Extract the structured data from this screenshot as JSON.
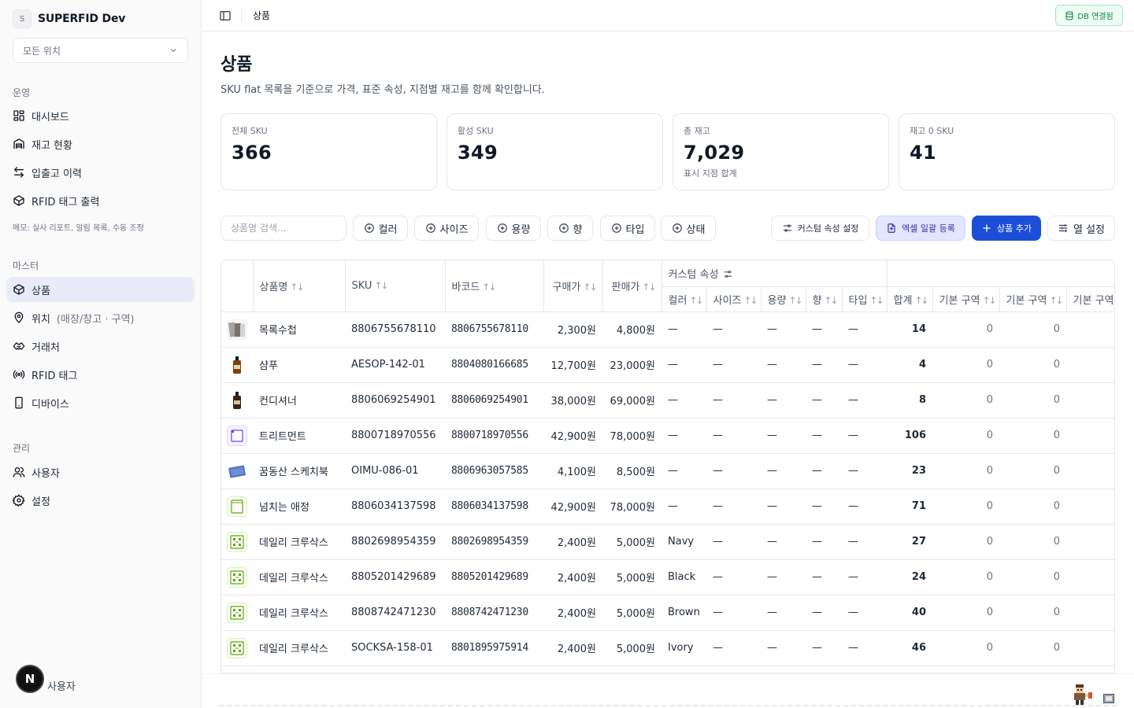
{
  "app": {
    "logo_letter": "S",
    "name": "SUPERFID Dev"
  },
  "location_select": {
    "value": "모든 위치"
  },
  "sidebar": {
    "sections": {
      "operations": "운영",
      "master": "마스터",
      "admin": "관리"
    },
    "items": [
      {
        "id": "dashboard",
        "label": "대시보드"
      },
      {
        "id": "inventory",
        "label": "재고 현황"
      },
      {
        "id": "history",
        "label": "입출고 이력"
      },
      {
        "id": "rfid-print",
        "label": "RFID 태그 출력"
      },
      {
        "id": "products",
        "label": "상품"
      },
      {
        "id": "locations",
        "label": "위치",
        "sub": "(매장/창고 · 구역)"
      },
      {
        "id": "partners",
        "label": "거래처"
      },
      {
        "id": "rfid-tags",
        "label": "RFID 태그"
      },
      {
        "id": "devices",
        "label": "디바이스"
      },
      {
        "id": "users",
        "label": "사용자"
      },
      {
        "id": "settings",
        "label": "설정"
      }
    ],
    "memo": "메모: 실사 리포트, 알림 목록, 수동 조정",
    "user_avatar": "N",
    "user_label": "사용자"
  },
  "topbar": {
    "breadcrumb": "상품",
    "db_status": "DB 연결됨",
    "db_color": "#15803d"
  },
  "page": {
    "title": "상품",
    "description": "SKU flat 목록을 기준으로 가격, 표준 속성, 지점별 재고를 함께 확인합니다."
  },
  "stats": [
    {
      "label": "전체 SKU",
      "value": "366",
      "sub": ""
    },
    {
      "label": "활성 SKU",
      "value": "349",
      "sub": ""
    },
    {
      "label": "총 재고",
      "value": "7,029",
      "sub": "표시 지점 합계"
    },
    {
      "label": "재고 0 SKU",
      "value": "41",
      "sub": ""
    }
  ],
  "toolbar": {
    "search_placeholder": "상품명 검색...",
    "filters": [
      "컬러",
      "사이즈",
      "용량",
      "향",
      "타입",
      "상태"
    ],
    "custom_attr_button": "커스텀 속성 설정",
    "excel_button": "엑셀 일괄 등록",
    "add_button": "상품 추가",
    "columns_button": "열 설정",
    "primary_color": "#1d4ed8"
  },
  "table": {
    "group_header": "커스텀 속성",
    "columns": {
      "name": "상품명",
      "sku": "SKU",
      "barcode": "바코드",
      "cost": "구매가",
      "price": "판매가",
      "color": "컬러",
      "size": "사이즈",
      "volume": "용량",
      "scent": "향",
      "type": "타입",
      "total": "합계",
      "zone1": "기본 구역",
      "zone2": "기본 구역",
      "zone3": "기본 구역"
    },
    "sort_glyph": "↑↓",
    "rows": [
      {
        "thumb": "notebook-photo",
        "name": "목록수첩",
        "sku": "8806755678110",
        "barcode": "8806755678110",
        "cost": "2,300원",
        "price": "4,800원",
        "color": "—",
        "size": "—",
        "volume": "—",
        "scent": "—",
        "type": "—",
        "total": "14",
        "z1": "0",
        "z2": "0"
      },
      {
        "thumb": "bottle-photo",
        "name": "샴푸",
        "sku": "AESOP-142-01",
        "barcode": "8804080166685",
        "cost": "12,700원",
        "price": "23,000원",
        "color": "—",
        "size": "—",
        "volume": "—",
        "scent": "—",
        "type": "—",
        "total": "4",
        "z1": "0",
        "z2": "0"
      },
      {
        "thumb": "bottle-dark-photo",
        "name": "컨디셔너",
        "sku": "8806069254901",
        "barcode": "8806069254901",
        "cost": "38,000원",
        "price": "69,000원",
        "color": "—",
        "size": "—",
        "volume": "—",
        "scent": "—",
        "type": "—",
        "total": "8",
        "z1": "0",
        "z2": "0"
      },
      {
        "thumb": "box-purple-icon",
        "name": "트리트먼트",
        "sku": "8800718970556",
        "barcode": "8800718970556",
        "cost": "42,900원",
        "price": "78,000원",
        "color": "—",
        "size": "—",
        "volume": "—",
        "scent": "—",
        "type": "—",
        "total": "106",
        "z1": "0",
        "z2": "0"
      },
      {
        "thumb": "sketchbook-photo",
        "name": "꿈동산 스케치북",
        "sku": "OIMU-086-01",
        "barcode": "8806963057585",
        "cost": "4,100원",
        "price": "8,500원",
        "color": "—",
        "size": "—",
        "volume": "—",
        "scent": "—",
        "type": "—",
        "total": "23",
        "z1": "0",
        "z2": "0"
      },
      {
        "thumb": "box-green-icon",
        "name": "넘치는 애정",
        "sku": "8806034137598",
        "barcode": "8806034137598",
        "cost": "42,900원",
        "price": "78,000원",
        "color": "—",
        "size": "—",
        "volume": "—",
        "scent": "—",
        "type": "—",
        "total": "71",
        "z1": "0",
        "z2": "0"
      },
      {
        "thumb": "grid-green-icon",
        "name": "데일리 크루삭스",
        "sku": "8802698954359",
        "barcode": "8802698954359",
        "cost": "2,400원",
        "price": "5,000원",
        "color": "Navy",
        "size": "—",
        "volume": "—",
        "scent": "—",
        "type": "—",
        "total": "27",
        "z1": "0",
        "z2": "0"
      },
      {
        "thumb": "grid-green-icon",
        "name": "데일리 크루삭스",
        "sku": "8805201429689",
        "barcode": "8805201429689",
        "cost": "2,400원",
        "price": "5,000원",
        "color": "Black",
        "size": "—",
        "volume": "—",
        "scent": "—",
        "type": "—",
        "total": "24",
        "z1": "0",
        "z2": "0"
      },
      {
        "thumb": "grid-green-icon",
        "name": "데일리 크루삭스",
        "sku": "8808742471230",
        "barcode": "8808742471230",
        "cost": "2,400원",
        "price": "5,000원",
        "color": "Brown",
        "size": "—",
        "volume": "—",
        "scent": "—",
        "type": "—",
        "total": "40",
        "z1": "0",
        "z2": "0"
      },
      {
        "thumb": "grid-green-icon",
        "name": "데일리 크루삭스",
        "sku": "SOCKSA-158-01",
        "barcode": "8801895975914",
        "cost": "2,400원",
        "price": "5,000원",
        "color": "Ivory",
        "size": "—",
        "volume": "—",
        "scent": "—",
        "type": "—",
        "total": "46",
        "z1": "0",
        "z2": "0"
      }
    ]
  }
}
